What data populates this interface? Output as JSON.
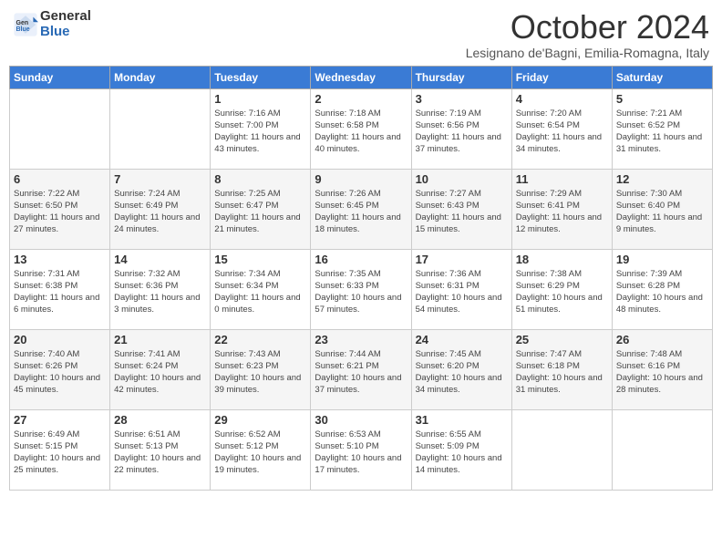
{
  "header": {
    "logo_general": "General",
    "logo_blue": "Blue",
    "title": "October 2024",
    "location": "Lesignano de'Bagni, Emilia-Romagna, Italy"
  },
  "weekdays": [
    "Sunday",
    "Monday",
    "Tuesday",
    "Wednesday",
    "Thursday",
    "Friday",
    "Saturday"
  ],
  "weeks": [
    [
      null,
      null,
      {
        "day": 1,
        "sunrise": "7:16 AM",
        "sunset": "7:00 PM",
        "daylight": "11 hours and 43 minutes."
      },
      {
        "day": 2,
        "sunrise": "7:18 AM",
        "sunset": "6:58 PM",
        "daylight": "11 hours and 40 minutes."
      },
      {
        "day": 3,
        "sunrise": "7:19 AM",
        "sunset": "6:56 PM",
        "daylight": "11 hours and 37 minutes."
      },
      {
        "day": 4,
        "sunrise": "7:20 AM",
        "sunset": "6:54 PM",
        "daylight": "11 hours and 34 minutes."
      },
      {
        "day": 5,
        "sunrise": "7:21 AM",
        "sunset": "6:52 PM",
        "daylight": "11 hours and 31 minutes."
      }
    ],
    [
      {
        "day": 6,
        "sunrise": "7:22 AM",
        "sunset": "6:50 PM",
        "daylight": "11 hours and 27 minutes."
      },
      {
        "day": 7,
        "sunrise": "7:24 AM",
        "sunset": "6:49 PM",
        "daylight": "11 hours and 24 minutes."
      },
      {
        "day": 8,
        "sunrise": "7:25 AM",
        "sunset": "6:47 PM",
        "daylight": "11 hours and 21 minutes."
      },
      {
        "day": 9,
        "sunrise": "7:26 AM",
        "sunset": "6:45 PM",
        "daylight": "11 hours and 18 minutes."
      },
      {
        "day": 10,
        "sunrise": "7:27 AM",
        "sunset": "6:43 PM",
        "daylight": "11 hours and 15 minutes."
      },
      {
        "day": 11,
        "sunrise": "7:29 AM",
        "sunset": "6:41 PM",
        "daylight": "11 hours and 12 minutes."
      },
      {
        "day": 12,
        "sunrise": "7:30 AM",
        "sunset": "6:40 PM",
        "daylight": "11 hours and 9 minutes."
      }
    ],
    [
      {
        "day": 13,
        "sunrise": "7:31 AM",
        "sunset": "6:38 PM",
        "daylight": "11 hours and 6 minutes."
      },
      {
        "day": 14,
        "sunrise": "7:32 AM",
        "sunset": "6:36 PM",
        "daylight": "11 hours and 3 minutes."
      },
      {
        "day": 15,
        "sunrise": "7:34 AM",
        "sunset": "6:34 PM",
        "daylight": "11 hours and 0 minutes."
      },
      {
        "day": 16,
        "sunrise": "7:35 AM",
        "sunset": "6:33 PM",
        "daylight": "10 hours and 57 minutes."
      },
      {
        "day": 17,
        "sunrise": "7:36 AM",
        "sunset": "6:31 PM",
        "daylight": "10 hours and 54 minutes."
      },
      {
        "day": 18,
        "sunrise": "7:38 AM",
        "sunset": "6:29 PM",
        "daylight": "10 hours and 51 minutes."
      },
      {
        "day": 19,
        "sunrise": "7:39 AM",
        "sunset": "6:28 PM",
        "daylight": "10 hours and 48 minutes."
      }
    ],
    [
      {
        "day": 20,
        "sunrise": "7:40 AM",
        "sunset": "6:26 PM",
        "daylight": "10 hours and 45 minutes."
      },
      {
        "day": 21,
        "sunrise": "7:41 AM",
        "sunset": "6:24 PM",
        "daylight": "10 hours and 42 minutes."
      },
      {
        "day": 22,
        "sunrise": "7:43 AM",
        "sunset": "6:23 PM",
        "daylight": "10 hours and 39 minutes."
      },
      {
        "day": 23,
        "sunrise": "7:44 AM",
        "sunset": "6:21 PM",
        "daylight": "10 hours and 37 minutes."
      },
      {
        "day": 24,
        "sunrise": "7:45 AM",
        "sunset": "6:20 PM",
        "daylight": "10 hours and 34 minutes."
      },
      {
        "day": 25,
        "sunrise": "7:47 AM",
        "sunset": "6:18 PM",
        "daylight": "10 hours and 31 minutes."
      },
      {
        "day": 26,
        "sunrise": "7:48 AM",
        "sunset": "6:16 PM",
        "daylight": "10 hours and 28 minutes."
      }
    ],
    [
      {
        "day": 27,
        "sunrise": "6:49 AM",
        "sunset": "5:15 PM",
        "daylight": "10 hours and 25 minutes."
      },
      {
        "day": 28,
        "sunrise": "6:51 AM",
        "sunset": "5:13 PM",
        "daylight": "10 hours and 22 minutes."
      },
      {
        "day": 29,
        "sunrise": "6:52 AM",
        "sunset": "5:12 PM",
        "daylight": "10 hours and 19 minutes."
      },
      {
        "day": 30,
        "sunrise": "6:53 AM",
        "sunset": "5:10 PM",
        "daylight": "10 hours and 17 minutes."
      },
      {
        "day": 31,
        "sunrise": "6:55 AM",
        "sunset": "5:09 PM",
        "daylight": "10 hours and 14 minutes."
      },
      null,
      null
    ]
  ]
}
